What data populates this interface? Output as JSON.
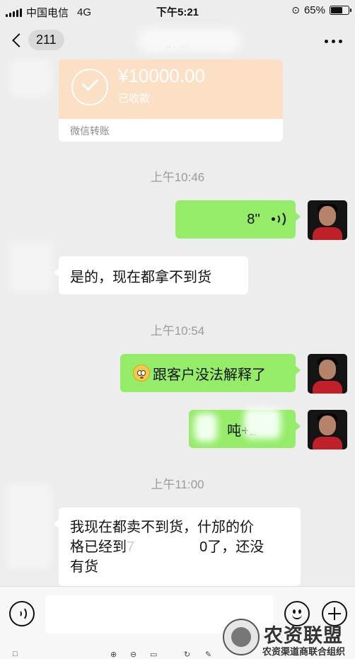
{
  "status_bar": {
    "carrier": "中国电信",
    "network": "4G",
    "time": "下午5:21",
    "battery_percent": "65%",
    "battery_level": 0.65
  },
  "nav": {
    "back_count": "211",
    "title": "群聊"
  },
  "transfer": {
    "amount": "¥10000.00",
    "status": "已收款",
    "label": "微信转账",
    "card_color": "#fce0c6"
  },
  "messages": {
    "ts1": "上午10:46",
    "voice_duration": "8''",
    "reply1": "是的，现在都拿不到货",
    "ts2": "上午10:54",
    "sent2": "跟客户没法解释了",
    "sent3": "吨+2",
    "ts3": "上午11:00",
    "reply2_line1": "我现在都卖不到货，什邡的价",
    "reply2_line2a": "格已经到",
    "reply2_line2b": "7",
    "reply2_line2c": "0了，还没",
    "reply2_line3": "有货"
  },
  "colors": {
    "sent_bubble": "#95ec69",
    "received_bubble": "#ffffff",
    "background": "#ededed"
  },
  "icons": [
    "voice-input-icon",
    "emoji-icon",
    "plus-icon",
    "back-chevron-icon",
    "more-icon",
    "check-icon",
    "voice-wave-icon"
  ],
  "watermark": {
    "title": "农资联盟",
    "subtitle": "农资渠道商联合组织"
  }
}
